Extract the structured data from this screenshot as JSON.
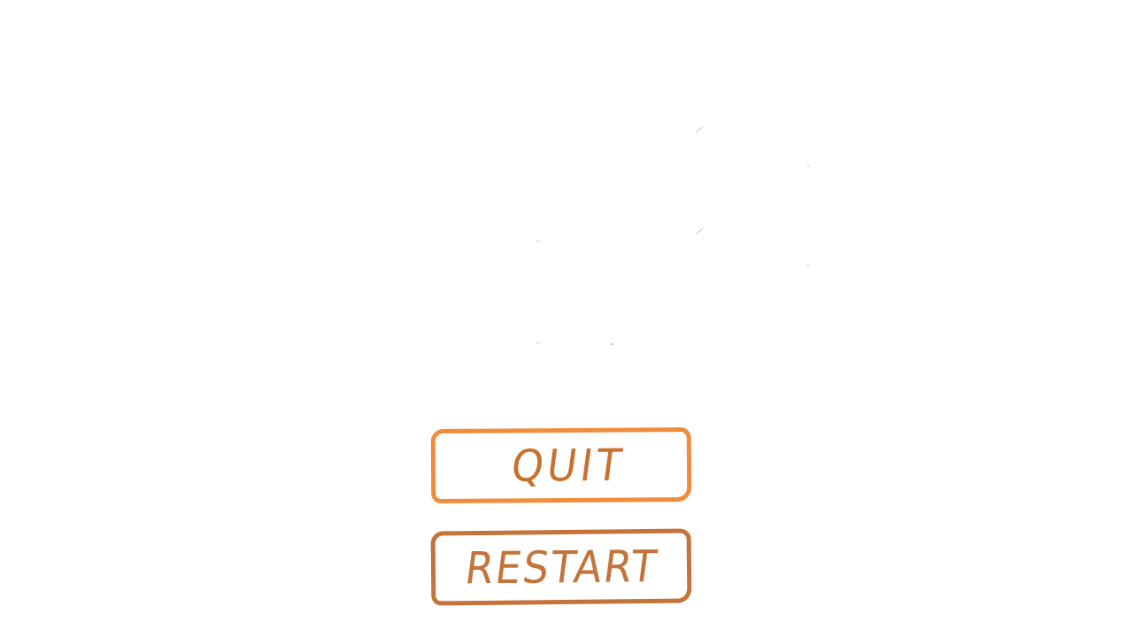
{
  "menu": {
    "quit_label": "QUIT",
    "restart_label": "RESTART"
  },
  "colors": {
    "quit_border": "#f08c3c",
    "quit_text": "#c8702e",
    "restart_border": "#c4733a",
    "restart_text": "#c4733a",
    "background": "#ffffff"
  }
}
